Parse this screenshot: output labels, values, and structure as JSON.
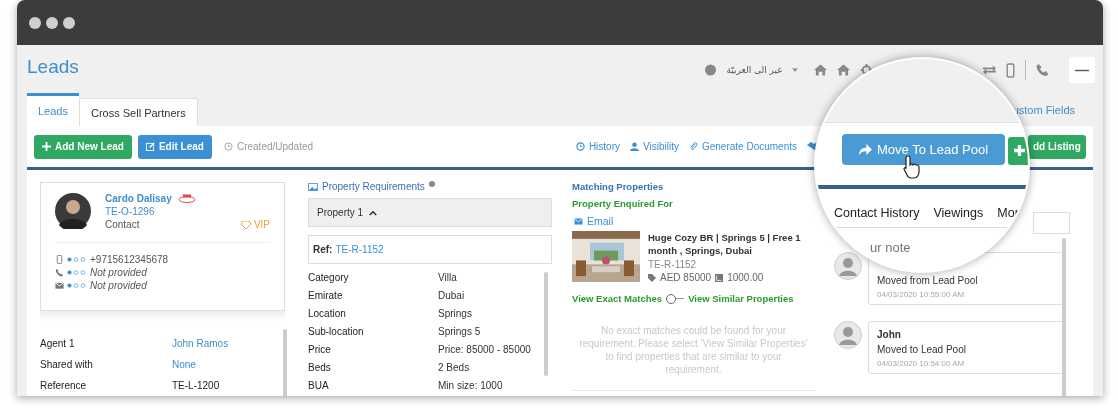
{
  "header": {
    "title": "Leads",
    "language": "غير الى العربيّة"
  },
  "tabs": [
    {
      "label": "Leads",
      "selected": true
    },
    {
      "label": "Cross Sell Partners",
      "selected": false
    }
  ],
  "custom_fields_link": "ustom Fields",
  "toolbar": {
    "buttons": [
      {
        "label": "Add New Lead",
        "kind": "add"
      },
      {
        "label": "Edit Lead",
        "kind": "edit"
      }
    ],
    "created_updated": "Created/Updated",
    "links": [
      {
        "label": "History",
        "kind": "history"
      },
      {
        "label": "Visibility",
        "kind": "visibility"
      },
      {
        "label": "Generate Documents",
        "kind": "documents"
      }
    ],
    "add_listing": "dd Listing"
  },
  "contact": {
    "name": "Cardo Dalisay",
    "ref": "TE-O-1296",
    "type": "Contact",
    "badge": "VIP",
    "channels": [
      {
        "kind": "mobile",
        "value": "+9715612345678",
        "provided": true
      },
      {
        "kind": "phone",
        "value": "Not provided",
        "provided": false
      },
      {
        "kind": "email",
        "value": "Not provided",
        "provided": false
      }
    ]
  },
  "details": [
    {
      "label": "Agent 1",
      "value": "John Ramos",
      "link": true
    },
    {
      "label": "Shared with",
      "value": "None",
      "link": true
    },
    {
      "label": "Reference",
      "value": "TE-L-1200",
      "link": false
    }
  ],
  "requirements": {
    "title": "Property Requirements",
    "property": "Property 1",
    "expanded": true,
    "ref_label": "Ref:",
    "ref": "TE-R-1152",
    "rows": [
      {
        "label": "Category",
        "value": "Villa"
      },
      {
        "label": "Emirate",
        "value": "Dubai"
      },
      {
        "label": "Location",
        "value": "Springs"
      },
      {
        "label": "Sub-location",
        "value": "Springs 5"
      },
      {
        "label": "Price",
        "value": "Price: 85000 - 85000"
      },
      {
        "label": "Beds",
        "value": "2 Beds"
      },
      {
        "label": "BUA",
        "value": "Min size: 1000"
      }
    ]
  },
  "matching": {
    "title": "Matching Properties",
    "enquired": "Property Enquired For",
    "email": "Email",
    "listing": {
      "title": "Huge Cozy BR | Springs 5 | Free 1 month , Springs, Dubai",
      "ref": "TE-R-1152",
      "price": "AED 85000",
      "size": "1000.00"
    },
    "exact_label": "View Exact Matches",
    "similar_label": "View Similar Properties",
    "similar_on": false,
    "message": "No exact matches could be found for your requirement. Please select 'View Similar Properties' to find properties that are similar to your requirement."
  },
  "notes": [
    {
      "text": "Moved from Lead Pool",
      "time": "04/03/2020 10:55:00 AM"
    },
    {
      "name": "John",
      "text": "Moved to Lead Pool",
      "time": "04/03/2020 10:54:00 AM"
    }
  ],
  "magnifier": {
    "button": "Move To Lead Pool",
    "tabs": [
      "Contact History",
      "Viewings",
      "Mor"
    ],
    "placeholder": "ur note"
  }
}
